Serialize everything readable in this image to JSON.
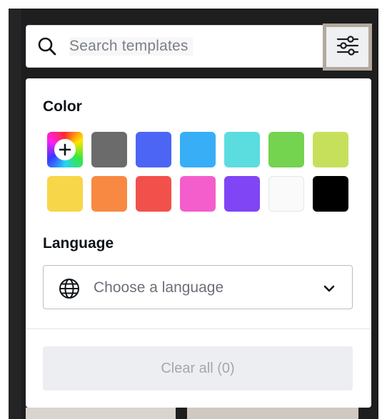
{
  "search": {
    "placeholder": "Search templates",
    "icon": "search-icon"
  },
  "filter_button": {
    "icon": "sliders-icon"
  },
  "filters": {
    "color": {
      "title": "Color",
      "add_icon": "plus-icon",
      "swatches": [
        {
          "name": "add-custom-color",
          "color": "rainbow"
        },
        {
          "name": "gray",
          "color": "#6b6b6b"
        },
        {
          "name": "blue",
          "color": "#4d65f5"
        },
        {
          "name": "sky-blue",
          "color": "#38aef7"
        },
        {
          "name": "turquoise",
          "color": "#5bdde0"
        },
        {
          "name": "green",
          "color": "#74d34f"
        },
        {
          "name": "lime",
          "color": "#c6e05c"
        },
        {
          "name": "yellow",
          "color": "#f8d649"
        },
        {
          "name": "orange",
          "color": "#f88942"
        },
        {
          "name": "red",
          "color": "#f2514b"
        },
        {
          "name": "pink",
          "color": "#f45dcc"
        },
        {
          "name": "purple",
          "color": "#8046f5"
        },
        {
          "name": "white",
          "color": "#fafafa"
        },
        {
          "name": "black",
          "color": "#000000"
        }
      ]
    },
    "language": {
      "title": "Language",
      "icon": "globe-icon",
      "placeholder": "Choose a language",
      "chevron": "chevron-down-icon"
    }
  },
  "actions": {
    "clear_all_label": "Clear all (0)"
  }
}
